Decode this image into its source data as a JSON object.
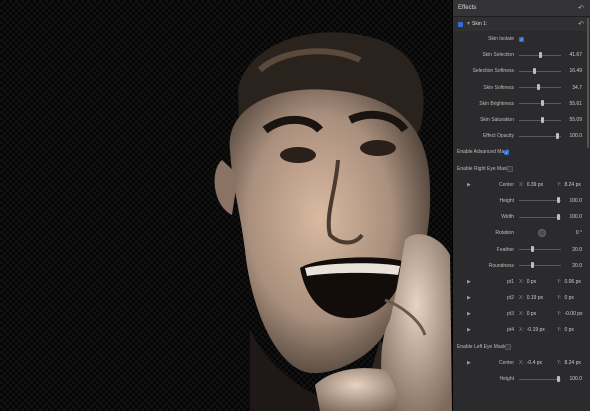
{
  "inspector": {
    "title": "Effects",
    "section": "Skin 1:",
    "skin_isolate_label": "Skin Isolate",
    "sliders": [
      {
        "label": "Skin Selection",
        "value": "41.67",
        "pos": 0.5
      },
      {
        "label": "Selection Softness",
        "value": "16.49",
        "pos": 0.35
      },
      {
        "label": "Skin Softness",
        "value": "34.7",
        "pos": 0.45
      },
      {
        "label": "Skin Brightness",
        "value": "55.61",
        "pos": 0.55
      },
      {
        "label": "Skin Saturation",
        "value": "55.09",
        "pos": 0.55
      },
      {
        "label": "Effect Opacity",
        "value": "100.0",
        "pos": 0.92
      }
    ],
    "enable_advanced_mask": "Enable Advanced Mask",
    "enable_right_eye_mask": "Enable Right Eye Mask",
    "right_eye": {
      "center": {
        "label": "Center",
        "x": "0.39 px",
        "y": "8.24 px"
      },
      "height": {
        "label": "Height",
        "value": "100.0"
      },
      "width": {
        "label": "Width",
        "value": "100.0"
      },
      "rotation": {
        "label": "Rotation",
        "value": "0 °"
      },
      "feather": {
        "label": "Feather",
        "value": "20.0"
      },
      "roundness": {
        "label": "Roundness",
        "value": "20.0"
      },
      "pt1": {
        "label": "pt1",
        "x": "0 px",
        "y": "0.06 px"
      },
      "pt2": {
        "label": "pt2",
        "x": "0.19 px",
        "y": "0 px"
      },
      "pt3": {
        "label": "pt3",
        "x": "0 px",
        "y": "-0.00 px"
      },
      "pt4": {
        "label": "pt4",
        "x": "-0.19 px",
        "y": "0 px"
      }
    },
    "enable_left_eye_mask": "Enable Left Eye Mask",
    "left_eye": {
      "center": {
        "label": "Center",
        "x": "-0.4 px",
        "y": "8.24 px"
      },
      "height": {
        "label": "Height",
        "value": "100.0"
      }
    },
    "axis_x": "X:",
    "axis_y": "Y:"
  }
}
